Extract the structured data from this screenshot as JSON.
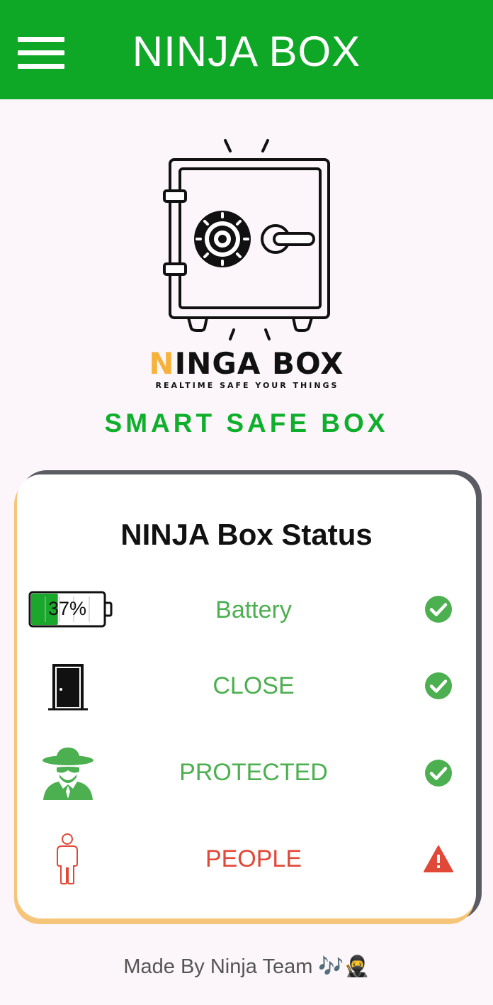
{
  "header": {
    "title": "NINJA BOX"
  },
  "logo": {
    "brand_first": "N",
    "brand_rest": "INGA BOX",
    "tagline": "REALTIME SAFE YOUR THINGS"
  },
  "subtitle": "SMART SAFE BOX",
  "status_card": {
    "title": "NINJA Box Status",
    "battery": {
      "percent_text": "37%",
      "level": 0.37,
      "label": "Battery",
      "status": "check-circle-icon"
    },
    "rows": [
      {
        "label": "Battery",
        "status": "ok"
      },
      {
        "label": "CLOSE",
        "status": "ok"
      },
      {
        "label": "PROTECTED",
        "status": "ok"
      },
      {
        "label": "PEOPLE",
        "status": "warning"
      }
    ]
  },
  "footer": {
    "text": "Made By Ninja Team 🎶🥷"
  },
  "colors": {
    "appbar": "#0ea826",
    "ok": "#4caf50",
    "warning": "#e04838",
    "accent_gold": "#f6b23a"
  }
}
